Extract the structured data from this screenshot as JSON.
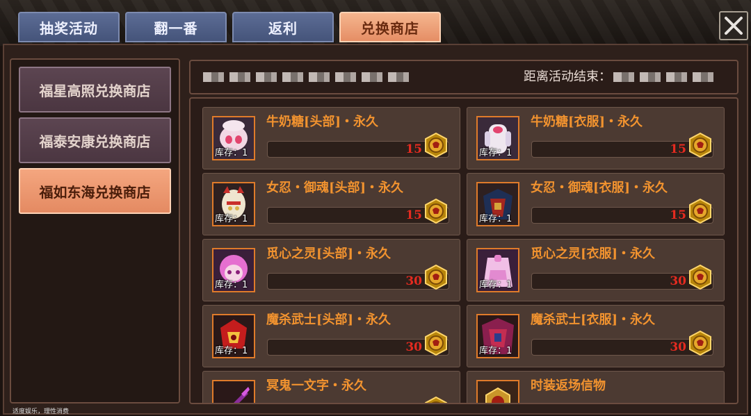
{
  "tabs": [
    {
      "label": "抽奖活动",
      "active": false
    },
    {
      "label": "翻一番",
      "active": false
    },
    {
      "label": "返利",
      "active": false
    },
    {
      "label": "兑换商店",
      "active": true
    }
  ],
  "close_icon": "close-icon",
  "sidebar": {
    "items": [
      {
        "label": "福星高照兑换商店",
        "active": false
      },
      {
        "label": "福泰安康兑换商店",
        "active": false
      },
      {
        "label": "福如东海兑换商店",
        "active": true
      }
    ]
  },
  "info_bar": {
    "end_label": "距离活动结束："
  },
  "products": [
    {
      "name": "牛奶糖[头部]・永久",
      "stock_label": "库存：1",
      "price": "15"
    },
    {
      "name": "牛奶糖[衣服]・永久",
      "stock_label": "库存：1",
      "price": "15"
    },
    {
      "name": "女忍・御魂[头部]・永久",
      "stock_label": "库存：1",
      "price": "15"
    },
    {
      "name": "女忍・御魂[衣服]・永久",
      "stock_label": "库存：1",
      "price": "15"
    },
    {
      "name": "觅心之灵[头部]・永久",
      "stock_label": "库存：1",
      "price": "30"
    },
    {
      "name": "觅心之灵[衣服]・永久",
      "stock_label": "库存：1",
      "price": "30"
    },
    {
      "name": "魔杀武士[头部]・永久",
      "stock_label": "库存：1",
      "price": "30"
    },
    {
      "name": "魔杀武士[衣服]・永久",
      "stock_label": "库存：1",
      "price": "30"
    },
    {
      "name": "冥鬼一文字・永久",
      "stock_label": "",
      "price": ""
    },
    {
      "name": "时装返场信物",
      "stock_label": "",
      "price": ""
    }
  ],
  "currency_icon": "gold-coin-icon",
  "footer": {
    "note": "适度娱乐，理性消费"
  },
  "colors": {
    "active_tab": "#e58e65",
    "inactive_tab": "#45547a",
    "item_name": "#f2932f",
    "price": "#e52b20",
    "thumb_border": "#e07b2a"
  }
}
